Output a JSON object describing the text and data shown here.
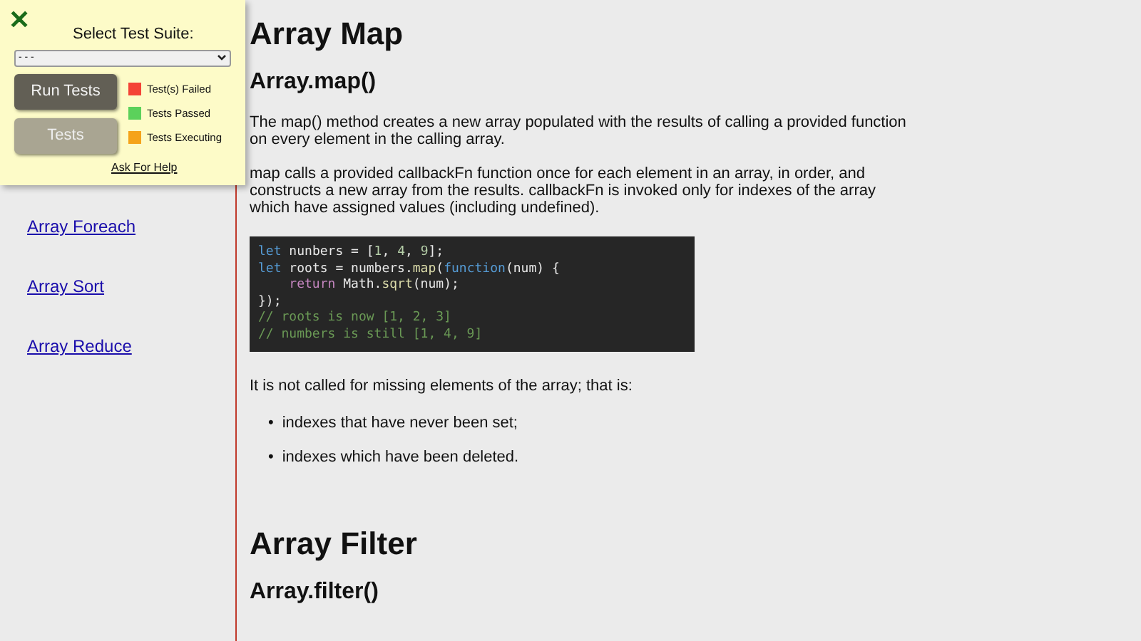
{
  "sidebar": {
    "links": [
      "Array Foreach",
      "Array Sort",
      "Array Reduce"
    ]
  },
  "test_panel": {
    "close": "✕",
    "select_label": "Select Test Suite:",
    "select_value": "- - -",
    "buttons": [
      {
        "label": "Run Tests",
        "disabled": false
      },
      {
        "label": "Tests",
        "disabled": true
      }
    ],
    "help_link": "Ask For Help",
    "legend": [
      {
        "label": "Test(s) Failed",
        "color": "#f44336"
      },
      {
        "label": "Tests Passed",
        "color": "#5bd15b"
      },
      {
        "label": "Tests Executing",
        "color": "#f5a31a"
      }
    ]
  },
  "sections": [
    {
      "title": "Array Map",
      "subtitle": "Array.map()",
      "paragraphs": [
        "The map() method creates a new array populated with the results of calling a provided function on every element in the calling array.",
        "map calls a provided callbackFn function once for each element in an array, in order, and constructs a new array from the results. callbackFn is invoked only for indexes of the array which have assigned values (including undefined)."
      ],
      "code": [
        [
          {
            "t": "let",
            "kind": "keyword"
          },
          {
            "t": " nunbers = [",
            "kind": "plain"
          },
          {
            "t": "1",
            "kind": "number"
          },
          {
            "t": ", ",
            "kind": "plain"
          },
          {
            "t": "4",
            "kind": "number"
          },
          {
            "t": ", ",
            "kind": "plain"
          },
          {
            "t": "9",
            "kind": "number"
          },
          {
            "t": "];",
            "kind": "plain"
          }
        ],
        [
          {
            "t": "let",
            "kind": "keyword"
          },
          {
            "t": " roots = numbers.",
            "kind": "plain"
          },
          {
            "t": "map",
            "kind": "func"
          },
          {
            "t": "(",
            "kind": "plain"
          },
          {
            "t": "function",
            "kind": "keyword"
          },
          {
            "t": "(num) {",
            "kind": "plain"
          }
        ],
        [
          {
            "t": "    return",
            "kind": "control"
          },
          {
            "t": " Math.",
            "kind": "plain"
          },
          {
            "t": "sqrt",
            "kind": "func"
          },
          {
            "t": "(num);",
            "kind": "plain"
          }
        ],
        [
          {
            "t": "});",
            "kind": "plain"
          }
        ],
        [
          {
            "t": "// roots is now [1, 2, 3]",
            "kind": "comment"
          }
        ],
        [
          {
            "t": "// numbers is still [1, 4, 9]",
            "kind": "comment"
          }
        ]
      ],
      "after": "It is not called for missing elements of the array; that is:",
      "bullets": [
        {
          "marker": "•",
          "text": "indexes that have never been set;"
        },
        {
          "marker": "•",
          "text": "indexes which have been deleted."
        }
      ]
    },
    {
      "title": "Array Filter",
      "subtitle": "Array.filter()"
    }
  ]
}
